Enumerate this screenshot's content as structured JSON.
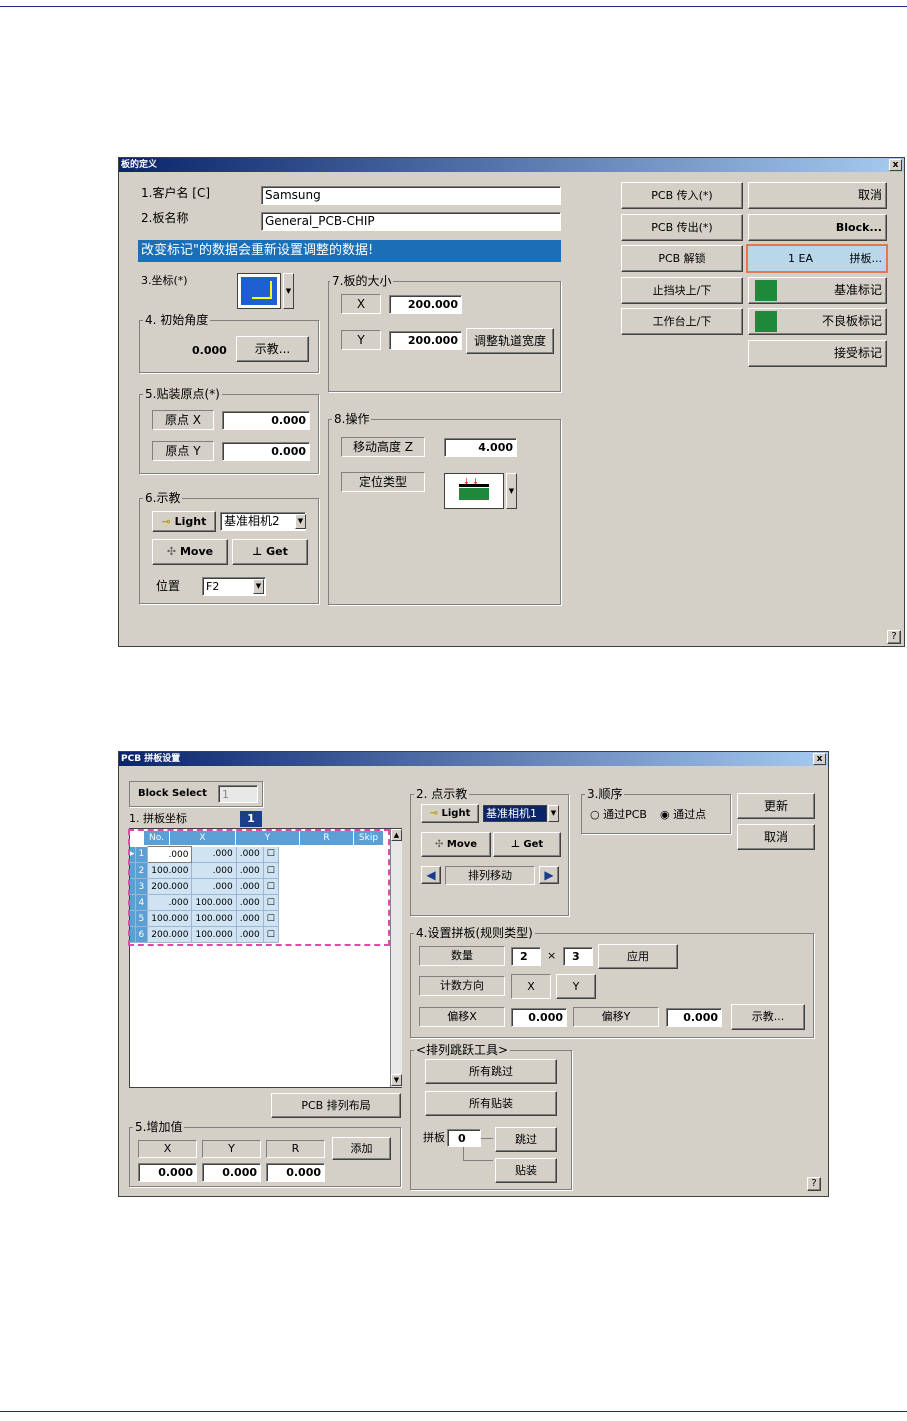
{
  "dlg1": {
    "title": "板的定义",
    "close": "x",
    "help": "?",
    "customer_label": "1.客户名 [C]",
    "customer_value": "Samsung",
    "board_label": "2.板名称",
    "board_value": "General_PCB-CHIP",
    "banner": "改变标记\"的数据会重新设置调整的数据!",
    "coord_label": "3.坐标(*)",
    "angle_group": "4. 初始角度",
    "angle_value": "0.000",
    "teach_btn": "示教...",
    "size_group": "7.板的大小",
    "x_label": "X",
    "x_value": "200.000",
    "y_label": "Y",
    "y_value": "200.000",
    "adjust_btn": "调整轨道宽度",
    "origin_group": "5.贴装原点(*)",
    "ox_label": "原点 X",
    "ox_value": "0.000",
    "oy_label": "原点 Y",
    "oy_value": "0.000",
    "op_group": "8.操作",
    "movez_label": "移动高度 Z",
    "movez_value": "4.000",
    "locate_label": "定位类型",
    "teach_group": "6.示教",
    "light_btn": "Light",
    "camera_select": "基准相机2",
    "move_btn": "Move",
    "get_btn": "Get",
    "pos_label": "位置",
    "pos_select": "F2",
    "right_buttons": {
      "pcb_in": "PCB 传入(*)",
      "cancel": "取消",
      "pcb_out": "PCB 传出(*)",
      "block": "Block...",
      "pcb_unlock": "PCB 解锁",
      "panel_ea": "1 EA",
      "panel_label": "拼板...",
      "stopper": "止挡块上/下",
      "fiducial": "基准标记",
      "table": "工作台上/下",
      "bad_mark": "不良板标记",
      "accept_mark": "接受标记"
    }
  },
  "dlg2": {
    "title": "PCB 拼板设置",
    "close": "x",
    "help": "?",
    "block_select_label": "Block Select",
    "block_select_value": "1",
    "coord_label": "1. 拼板坐标",
    "coord_badge": "1",
    "grid_headers": [
      "No.",
      "X",
      "Y",
      "R",
      "Skip"
    ],
    "grid_rows": [
      {
        "no": "1",
        "x": ".000",
        "y": ".000",
        "r": ".000"
      },
      {
        "no": "2",
        "x": "100.000",
        "y": ".000",
        "r": ".000"
      },
      {
        "no": "3",
        "x": "200.000",
        "y": ".000",
        "r": ".000"
      },
      {
        "no": "4",
        "x": ".000",
        "y": "100.000",
        "r": ".000"
      },
      {
        "no": "5",
        "x": "100.000",
        "y": "100.000",
        "r": ".000"
      },
      {
        "no": "6",
        "x": "200.000",
        "y": "100.000",
        "r": ".000"
      }
    ],
    "layout_btn": "PCB 排列布局",
    "inc_group": "5.增加值",
    "inc_headers": [
      "X",
      "Y",
      "R"
    ],
    "inc_values": [
      "0.000",
      "0.000",
      "0.000"
    ],
    "add_btn": "添加",
    "point_group": "2. 点示教",
    "light_btn": "Light",
    "camera_select": "基准相机1",
    "move_btn": "Move",
    "get_btn": "Get",
    "array_move": "排列移动",
    "order_group": "3.顺序",
    "order_opt1": "通过PCB",
    "order_opt2": "通过点",
    "update_btn": "更新",
    "cancel_btn": "取消",
    "panel_group": "4.设置拼板(规则类型)",
    "qty_label": "数量",
    "qty_a": "2",
    "qty_x": "×",
    "qty_b": "3",
    "apply_btn": "应用",
    "count_dir_label": "计数方向",
    "dir_x": "X",
    "dir_y": "Y",
    "offx_label": "偏移X",
    "offx_value": "0.000",
    "offy_label": "偏移Y",
    "offy_value": "0.000",
    "teach_btn": "示教...",
    "skip_group": "<排列跳跃工具>",
    "skip_all": "所有跳过",
    "place_all": "所有贴装",
    "panel_no_label": "拼板",
    "panel_no_value": "0",
    "skip_btn": "跳过",
    "place_btn": "贴装"
  }
}
